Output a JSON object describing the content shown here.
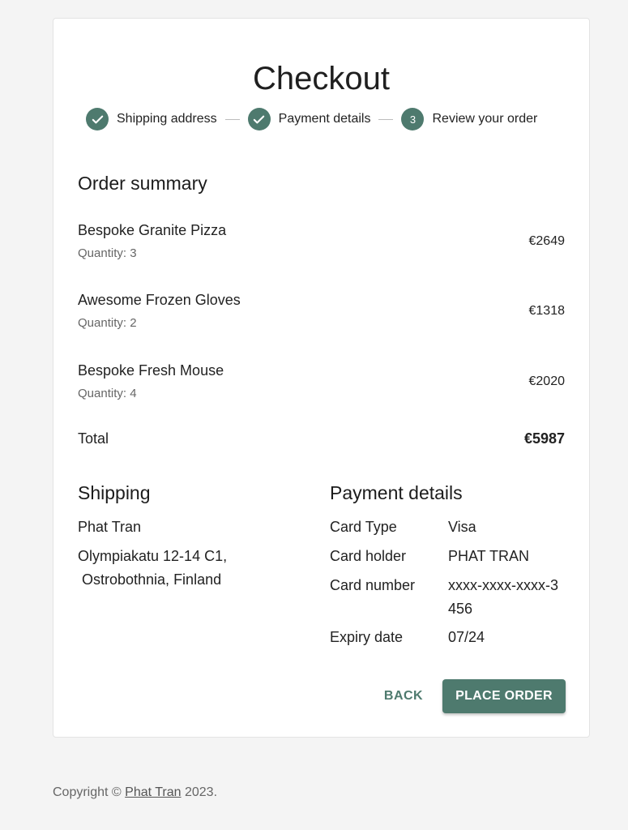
{
  "colors": {
    "accent": "#4e7a6e",
    "background": "#f4f4f4"
  },
  "page_title": "Checkout",
  "stepper": {
    "steps": [
      {
        "label": "Shipping address",
        "status": "completed",
        "icon": "check-icon"
      },
      {
        "label": "Payment details",
        "status": "completed",
        "icon": "check-icon"
      },
      {
        "label": "Review your order",
        "status": "active",
        "number": "3"
      }
    ]
  },
  "summary": {
    "title": "Order summary",
    "items": [
      {
        "name": "Bespoke Granite Pizza",
        "quantity": "Quantity: 3",
        "price": "€2649"
      },
      {
        "name": "Awesome Frozen Gloves",
        "quantity": "Quantity: 2",
        "price": "€1318"
      },
      {
        "name": "Bespoke Fresh Mouse",
        "quantity": "Quantity: 4",
        "price": "€2020"
      }
    ],
    "total_label": "Total",
    "total_value": "€5987"
  },
  "shipping": {
    "title": "Shipping",
    "name": "Phat Tran",
    "address_line1": "Olympiakatu 12-14 C1,",
    "address_line2": "Ostrobothnia, Finland"
  },
  "payment": {
    "title": "Payment details",
    "rows": [
      {
        "label": "Card Type",
        "value": "Visa"
      },
      {
        "label": "Card holder",
        "value": "PHAT TRAN"
      },
      {
        "label": "Card number",
        "value": "xxxx-xxxx-xxxx-3456"
      },
      {
        "label": "Expiry date",
        "value": "07/24"
      }
    ]
  },
  "actions": {
    "back_label": "BACK",
    "place_order_label": "PLACE ORDER"
  },
  "footer": {
    "prefix": "Copyright © ",
    "link_text": "Phat Tran",
    "suffix": " 2023."
  }
}
